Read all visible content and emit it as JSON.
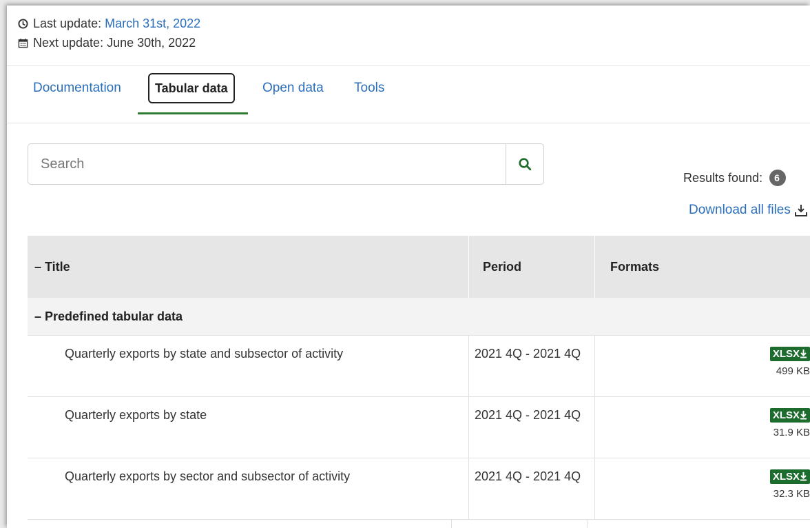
{
  "updates": {
    "last_label": "Last update:",
    "last_date": "March 31st, 2022",
    "next_label": "Next update: June 30th, 2022"
  },
  "tabs": {
    "documentation": "Documentation",
    "tabular": "Tabular data",
    "open_data": "Open data",
    "tools": "Tools"
  },
  "search": {
    "placeholder": "Search"
  },
  "results": {
    "label": "Results found:",
    "count": "6"
  },
  "download_all": "Download all files",
  "table": {
    "headers": {
      "title": "– Title",
      "period": "Period",
      "formats": "Formats"
    },
    "group": "– Predefined tabular data",
    "rows": [
      {
        "title": "Quarterly exports by state and subsector of activity",
        "period": "2021 4Q - 2021 4Q",
        "format": "XLSX",
        "size": "499 KB"
      },
      {
        "title": "Quarterly exports by state",
        "period": "2021 4Q - 2021 4Q",
        "format": "XLSX",
        "size": "31.9 KB"
      },
      {
        "title": "Quarterly exports by sector and subsector of activity",
        "period": "2021 4Q - 2021 4Q",
        "format": "XLSX",
        "size": "32.3 KB"
      }
    ]
  },
  "colors": {
    "link": "#2a6ebb",
    "accent_green": "#2e7d32",
    "xlsx_badge": "#1e6b2e"
  }
}
